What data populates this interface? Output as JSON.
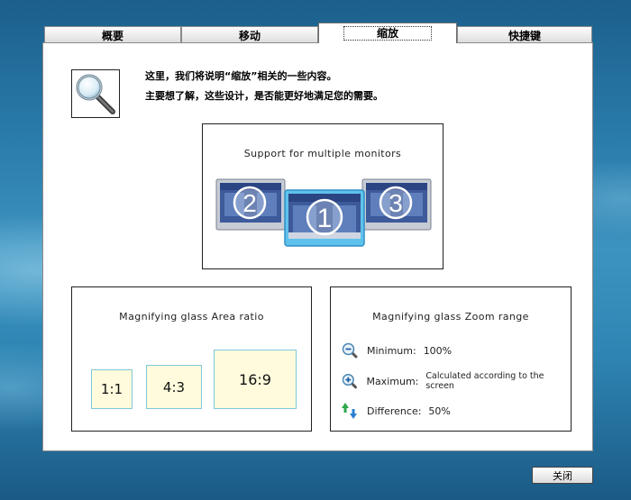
{
  "tabs": [
    {
      "label": "概要",
      "active": false
    },
    {
      "label": "移动",
      "active": false
    },
    {
      "label": "缩放",
      "active": true
    },
    {
      "label": "快捷键",
      "active": false
    }
  ],
  "intro": {
    "icon": "magnifier-icon",
    "line1": "这里，我们将说明“缩放”相关的一些内容。",
    "line2": "主要想了解，这些设计，是否能更好地满足您的需要。"
  },
  "monitors_box": {
    "title": "Support for multiple monitors",
    "monitors": [
      "2",
      "1",
      "3"
    ]
  },
  "area_ratio": {
    "title": "Magnifying glass Area ratio",
    "ratios": [
      "1:1",
      "4:3",
      "16:9"
    ]
  },
  "zoom_range": {
    "title": "Magnifying glass Zoom range",
    "rows": [
      {
        "icon": "zoom-out-icon",
        "label": "Minimum:",
        "value": "100%"
      },
      {
        "icon": "zoom-in-icon",
        "label": "Maximum:",
        "value": "Calculated according to the screen"
      },
      {
        "icon": "up-down-arrows-icon",
        "label": "Difference:",
        "value": "50%"
      }
    ]
  },
  "footer": {
    "close_label": "关闭"
  },
  "colors": {
    "ratio_fill": "#fffbdc",
    "ratio_border": "#7ec8d8",
    "monitor_accent": "#5fc2ec"
  }
}
